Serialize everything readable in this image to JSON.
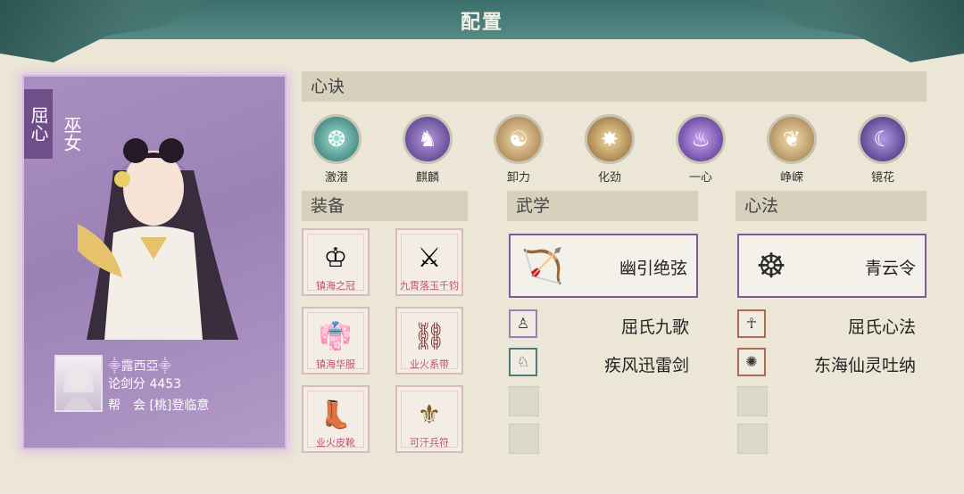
{
  "window": {
    "title": "配置"
  },
  "card": {
    "tag": "屈心",
    "subtitle": "巫女",
    "username": "露西亞",
    "score_label": "论剑分",
    "score": "4453",
    "guild_label": "帮　会",
    "guild": "[桃]登临意"
  },
  "sections": {
    "xinjue": "心诀",
    "equip": "装备",
    "wuxue": "武学",
    "xinfa": "心法"
  },
  "skills": [
    {
      "label": "激潜",
      "color": "#4fb3a8"
    },
    {
      "label": "麒麟",
      "color": "#6a4ca3"
    },
    {
      "label": "卸力",
      "color": "#c89a55"
    },
    {
      "label": "化劲",
      "color": "#b98a45"
    },
    {
      "label": "一心",
      "color": "#6e4aa8"
    },
    {
      "label": "峥嵘",
      "color": "#c7985b"
    },
    {
      "label": "镜花",
      "color": "#5c3d96"
    }
  ],
  "equipment": [
    {
      "label": "镇海之冠",
      "icon": "crown-icon"
    },
    {
      "label": "九霄落玉千钧",
      "icon": "sword-icon"
    },
    {
      "label": "镇海华服",
      "icon": "robe-icon"
    },
    {
      "label": "业火系带",
      "icon": "belt-icon"
    },
    {
      "label": "业火皮靴",
      "icon": "boots-icon"
    },
    {
      "label": "可汗兵符",
      "icon": "token-icon"
    }
  ],
  "wuxue": {
    "main": "幽引绝弦",
    "sub": [
      "屈氏九歌",
      "疾风迅雷剑"
    ]
  },
  "xinfa": {
    "main": "青云令",
    "sub": [
      "屈氏心法",
      "东海仙灵吐纳"
    ]
  }
}
